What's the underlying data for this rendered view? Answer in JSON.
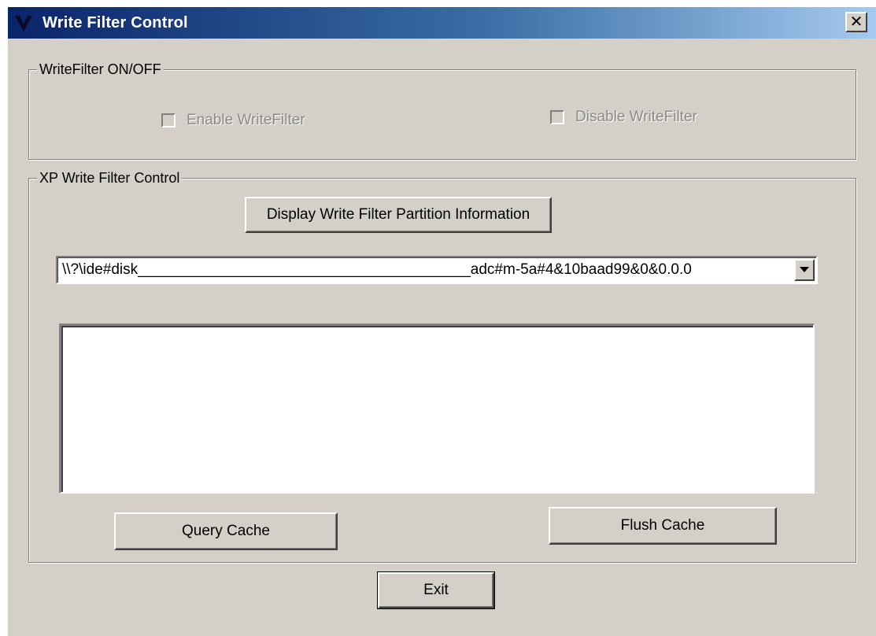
{
  "window": {
    "title": "Write Filter Control",
    "close_glyph": "✕",
    "icon": "app-logo-icon"
  },
  "writefilter_group": {
    "legend": "WriteFilter ON/OFF",
    "enable_label": "Enable WriteFilter",
    "enable_checked": false,
    "disable_label": "Disable WriteFilter",
    "disable_checked": false,
    "disabled_text_color": "#8a8a8a"
  },
  "xp_group": {
    "legend": "XP Write Filter Control",
    "display_button": "Display Write Filter Partition Information",
    "combo_value": "\\\\?\\ide#disk________________________________________adc#m-5a#4&10baad99&0&0.0.0",
    "combo_arrow_icon": "dropdown-arrow-icon",
    "query_button": "Query Cache",
    "flush_button": "Flush Cache"
  },
  "exit_button": "Exit",
  "colors": {
    "face": "#d4d0c8",
    "title_gradient_start": "#0a246a",
    "title_gradient_end": "#a6caf0"
  }
}
